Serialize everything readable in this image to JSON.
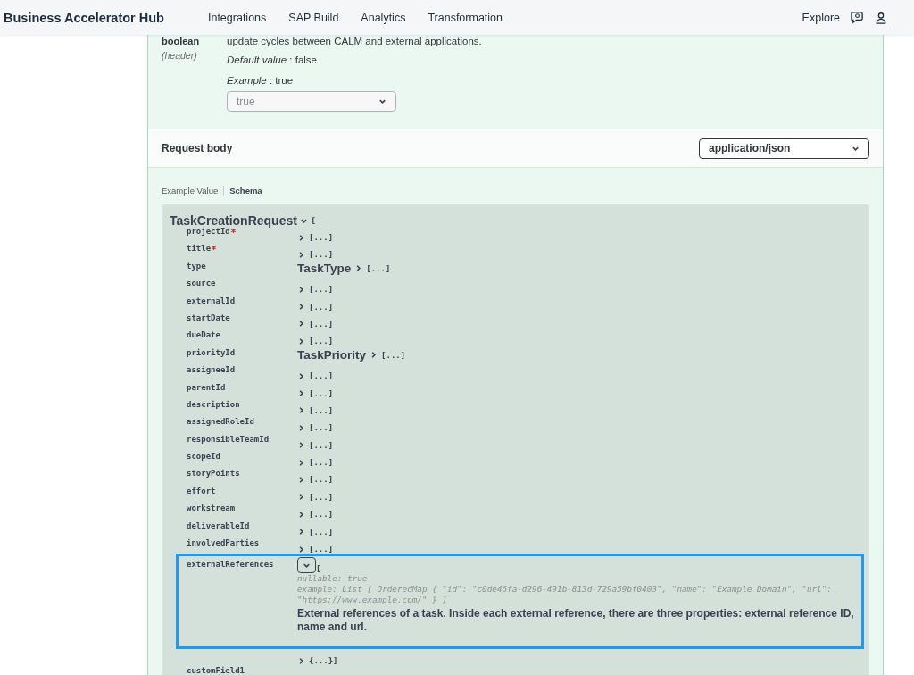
{
  "header": {
    "brand": "Business Accelerator Hub",
    "nav": [
      "Integrations",
      "SAP Build",
      "Analytics",
      "Transformation"
    ],
    "explore": "Explore"
  },
  "parameter": {
    "type": "boolean",
    "location": "(header)",
    "description": "update cycles between CALM and external applications.",
    "default_text": "*Default value* : false",
    "example_text": "*Example* : true",
    "select_value": "true"
  },
  "request_body": {
    "title": "Request body",
    "content_type": "application/json"
  },
  "view_tabs": [
    {
      "label": "Example Value",
      "selected": false
    },
    {
      "label": "Schema",
      "selected": true
    }
  ],
  "schema": {
    "model": "TaskCreationRequest",
    "open": "{",
    "properties": [
      {
        "name": "projectId",
        "required": true,
        "kind": "collapsed",
        "value": "[...]"
      },
      {
        "name": "title",
        "required": true,
        "kind": "collapsed",
        "value": "[...]"
      },
      {
        "name": "type",
        "required": false,
        "kind": "model",
        "model": "TaskType",
        "value": "[...]"
      },
      {
        "name": "source",
        "required": false,
        "kind": "collapsed",
        "value": "[...]"
      },
      {
        "name": "externalId",
        "required": false,
        "kind": "collapsed",
        "value": "[...]"
      },
      {
        "name": "startDate",
        "required": false,
        "kind": "collapsed",
        "value": "[...]"
      },
      {
        "name": "dueDate",
        "required": false,
        "kind": "collapsed",
        "value": "[...]"
      },
      {
        "name": "priorityId",
        "required": false,
        "kind": "model",
        "model": "TaskPriority",
        "value": "[...]"
      },
      {
        "name": "assigneeId",
        "required": false,
        "kind": "collapsed",
        "value": "[...]"
      },
      {
        "name": "parentId",
        "required": false,
        "kind": "collapsed",
        "value": "[...]"
      },
      {
        "name": "description",
        "required": false,
        "kind": "collapsed",
        "value": "[...]"
      },
      {
        "name": "assignedRoleId",
        "required": false,
        "kind": "collapsed",
        "value": "[...]"
      },
      {
        "name": "responsibleTeamId",
        "required": false,
        "kind": "collapsed",
        "value": "[...]"
      },
      {
        "name": "scopeId",
        "required": false,
        "kind": "collapsed",
        "value": "[...]"
      },
      {
        "name": "storyPoints",
        "required": false,
        "kind": "collapsed",
        "value": "[...]"
      },
      {
        "name": "effort",
        "required": false,
        "kind": "collapsed",
        "value": "[...]"
      },
      {
        "name": "workstream",
        "required": false,
        "kind": "collapsed",
        "value": "[...]"
      },
      {
        "name": "deliverableId",
        "required": false,
        "kind": "collapsed",
        "value": "[...]"
      },
      {
        "name": "involvedParties",
        "required": false,
        "kind": "collapsed",
        "value": "[...]"
      },
      {
        "name": "externalReferences",
        "required": false,
        "kind": "expanded",
        "focused": true,
        "open": "[",
        "nullable": "nullable: true",
        "example": "example: List [ OrderedMap { \"id\": \"c0de46fa-d296-491b-813d-729a59bf0403\", \"name\": \"Example Domain\", \"url\": \"https://www.example.com/\" } ]",
        "description": "External references of a task. Inside each external reference, there are three properties: external reference ID, name and url.",
        "items": "{...}]"
      },
      {
        "name": "customField1",
        "required": false,
        "kind": "cut"
      }
    ]
  }
}
